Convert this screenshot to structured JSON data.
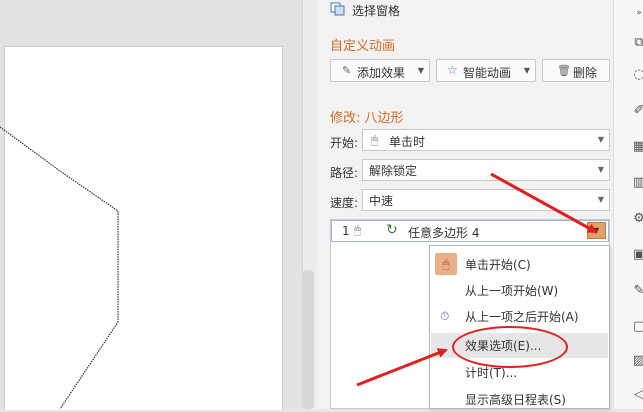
{
  "pane": {
    "header_title": "选择窗格",
    "custom_anim_title": "自定义动画",
    "add_effect_label": "添加效果",
    "smart_anim_label": "智能动画",
    "delete_label": "删除",
    "modify_title": "修改: 八边形",
    "start_label": "开始:",
    "start_value": "单击时",
    "path_label": "路径:",
    "path_value": "解除锁定",
    "speed_label": "速度:",
    "speed_value": "中速",
    "anim_item": {
      "index": "1",
      "name": "任意多边形 4"
    }
  },
  "context_menu": {
    "items": [
      {
        "label": "单击开始(C)",
        "icon": "mouse-click-icon"
      },
      {
        "label": "从上一项开始(W)",
        "icon": ""
      },
      {
        "label": "从上一项之后开始(A)",
        "icon": "clock-icon"
      },
      {
        "label": "效果选项(E)...",
        "icon": "",
        "highlighted": true
      },
      {
        "label": "计时(T)...",
        "icon": ""
      },
      {
        "label": "显示高级日程表(S)",
        "icon": ""
      }
    ]
  },
  "colors": {
    "accent_orange": "#d26b25",
    "annotation_red": "#e02020",
    "dropdown_orange": "#e5a06a"
  }
}
